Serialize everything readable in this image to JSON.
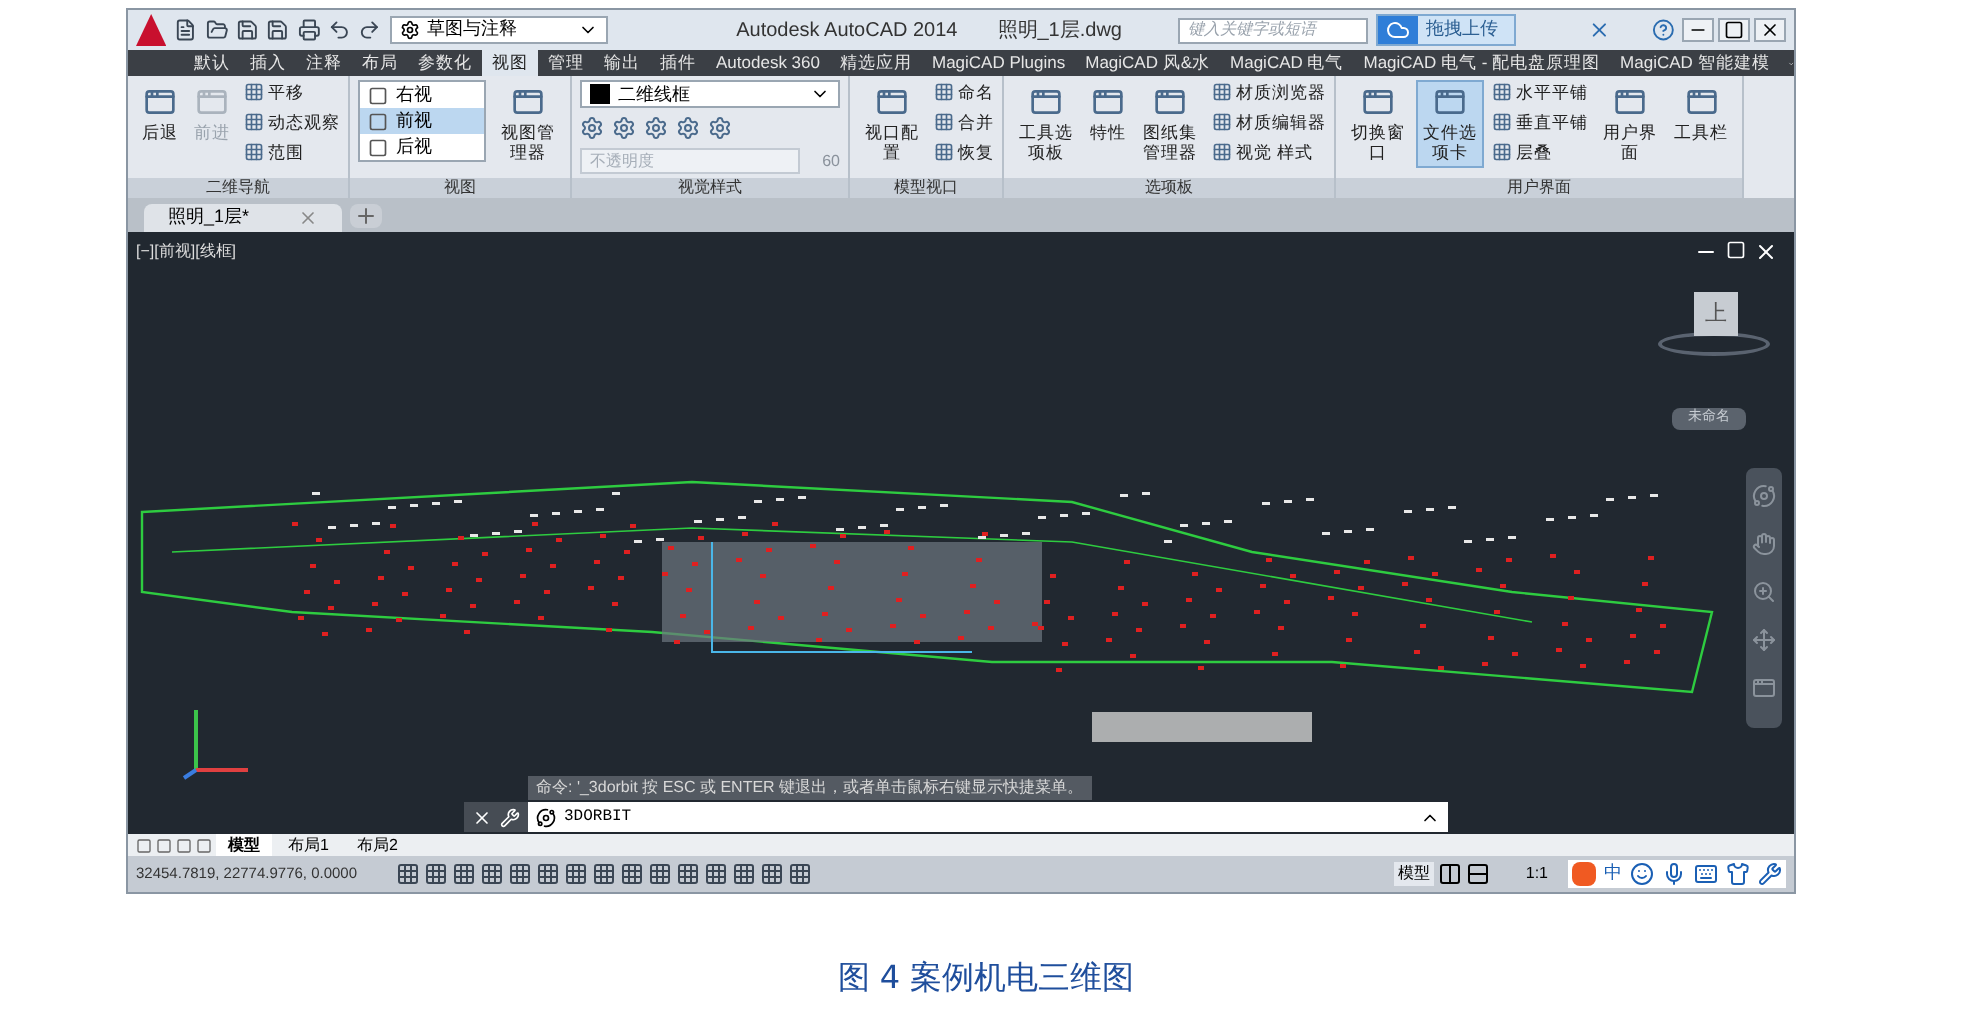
{
  "title_bar": {
    "workspace": "草图与注释",
    "app_title": "Autodesk AutoCAD 2014",
    "file_name": "照明_1层.dwg",
    "search_placeholder": "键入关键字或短语",
    "upload_label": "拖拽上传"
  },
  "menu_tabs": [
    {
      "label": "默认",
      "selected": false
    },
    {
      "label": "插入",
      "selected": false
    },
    {
      "label": "注释",
      "selected": false
    },
    {
      "label": "布局",
      "selected": false
    },
    {
      "label": "参数化",
      "selected": false
    },
    {
      "label": "视图",
      "selected": true
    },
    {
      "label": "管理",
      "selected": false
    },
    {
      "label": "输出",
      "selected": false
    },
    {
      "label": "插件",
      "selected": false
    },
    {
      "label": "Autodesk 360",
      "selected": false
    },
    {
      "label": "精选应用",
      "selected": false
    },
    {
      "label": "MagiCAD Plugins",
      "selected": false
    },
    {
      "label": "MagiCAD 风&水",
      "selected": false
    },
    {
      "label": "MagiCAD 电气",
      "selected": false
    },
    {
      "label": "MagiCAD 电气 - 配电盘原理图",
      "selected": false
    },
    {
      "label": "MagiCAD 智能建模",
      "selected": false
    }
  ],
  "ribbon_panels": [
    {
      "title": "二维导航",
      "groups": [
        {
          "kind": "big",
          "items": [
            {
              "label": "后退",
              "disabled": false
            },
            {
              "label": "前进",
              "disabled": true
            }
          ]
        },
        {
          "kind": "small",
          "items": [
            {
              "label": "平移"
            },
            {
              "label": "动态观察"
            },
            {
              "label": "范围"
            }
          ]
        }
      ]
    },
    {
      "title": "视图",
      "groups": [
        {
          "kind": "list",
          "items": [
            {
              "label": "右视",
              "selected": false
            },
            {
              "label": "前视",
              "selected": true
            },
            {
              "label": "后视",
              "selected": false
            }
          ]
        },
        {
          "kind": "big",
          "items": [
            {
              "label": "视图管理器",
              "disabled": false
            }
          ]
        }
      ]
    },
    {
      "title": "视觉样式",
      "groups": [
        {
          "kind": "style",
          "dropdown": "二维线框",
          "opacity_placeholder": "不透明度",
          "opacity_value": "60"
        }
      ]
    },
    {
      "title": "模型视口",
      "groups": [
        {
          "kind": "big",
          "items": [
            {
              "label": "视口配置",
              "disabled": false
            }
          ]
        },
        {
          "kind": "small",
          "items": [
            {
              "label": "命名"
            },
            {
              "label": "合并"
            },
            {
              "label": "恢复"
            }
          ]
        }
      ]
    },
    {
      "title": "选项板",
      "groups": [
        {
          "kind": "big",
          "items": [
            {
              "label": "工具选项板",
              "disabled": false
            },
            {
              "label": "特性",
              "disabled": false
            },
            {
              "label": "图纸集管理器",
              "disabled": false
            }
          ]
        },
        {
          "kind": "small",
          "items": [
            {
              "label": "材质浏览器"
            },
            {
              "label": "材质编辑器"
            },
            {
              "label": "视觉 样式"
            }
          ]
        }
      ]
    },
    {
      "title": "用户界面",
      "groups": [
        {
          "kind": "big",
          "items": [
            {
              "label": "切换窗口",
              "selected": false
            },
            {
              "label": "文件选项卡",
              "selected": true
            }
          ]
        },
        {
          "kind": "small",
          "items": [
            {
              "label": "水平平铺"
            },
            {
              "label": "垂直平铺"
            },
            {
              "label": "层叠"
            }
          ]
        },
        {
          "kind": "big",
          "items": [
            {
              "label": "用户界面",
              "selected": false
            },
            {
              "label": "工具栏",
              "selected": false
            }
          ]
        }
      ]
    }
  ],
  "file_tab": {
    "label": "照明_1层*"
  },
  "viewport": {
    "label": "[−][前视][线框]",
    "viewcube_face": "上",
    "ucs_name": "未命名"
  },
  "command_line": {
    "history": "命令: '_3dorbit 按 ESC 或 ENTER 键退出，或者单击鼠标右键显示快捷菜单。",
    "value": "3DORBIT"
  },
  "layout_tabs": [
    {
      "label": "模型",
      "selected": true
    },
    {
      "label": "布局1",
      "selected": false
    },
    {
      "label": "布局2",
      "selected": false
    }
  ],
  "status_bar": {
    "coordinates": "32454.7819, 22774.9776, 0.0000",
    "model_label": "模型",
    "scale": "1:1",
    "ime_label": "中"
  },
  "caption": "图 4 案例机电三维图"
}
